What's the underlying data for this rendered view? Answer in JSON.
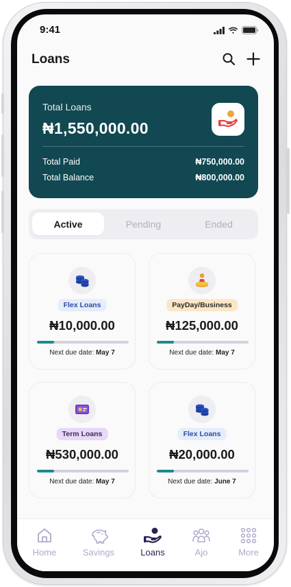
{
  "status_bar": {
    "time": "9:41"
  },
  "header": {
    "title": "Loans",
    "search_icon": "search-icon",
    "add_icon": "plus-icon"
  },
  "summary": {
    "title": "Total Loans",
    "total": "₦1,550,000.00",
    "icon": "hand-coin-icon",
    "rows": [
      {
        "label": "Total Paid",
        "value": "₦750,000.00"
      },
      {
        "label": "Total Balance",
        "value": "₦800,000.00"
      }
    ],
    "colors": {
      "card_bg": "#114852",
      "icon_accent": "#e8433f"
    }
  },
  "tabs": [
    {
      "label": "Active",
      "selected": true
    },
    {
      "label": "Pending",
      "selected": false
    },
    {
      "label": "Ended",
      "selected": false
    }
  ],
  "loans": [
    {
      "type": "Flex Loans",
      "amount": "₦10,000.00",
      "due_label": "Next due date:",
      "due_date": "May 7",
      "icon": "coin-stack-icon",
      "progress": 0.19,
      "badge_bg": "#e5edfb",
      "badge_color": "#2c4ea4"
    },
    {
      "type": "PayDay/Business",
      "amount": "₦125,000.00",
      "due_label": "Next due date:",
      "due_date": "May 7",
      "icon": "payday-icon",
      "progress": 0.19,
      "badge_bg": "#fbe7c6",
      "badge_color": "#2b2b2b"
    },
    {
      "type": "Term Loans",
      "amount": "₦530,000.00",
      "due_label": "Next due date:",
      "due_date": "May 7",
      "icon": "cash-icon",
      "progress": 0.19,
      "badge_bg": "#e7d8f7",
      "badge_color": "#3b2a5e"
    },
    {
      "type": "Flex Loans",
      "amount": "₦20,000.00",
      "due_label": "Next due date:",
      "due_date": "June 7",
      "icon": "coin-stack-icon",
      "progress": 0.19,
      "badge_bg": "#e5edfb",
      "badge_color": "#2c4ea4"
    }
  ],
  "nav": [
    {
      "label": "Home",
      "icon": "home-icon",
      "active": false
    },
    {
      "label": "Savings",
      "icon": "piggy-bank-icon",
      "active": false
    },
    {
      "label": "Loans",
      "icon": "loan-hand-icon",
      "active": true
    },
    {
      "label": "Ajo",
      "icon": "group-icon",
      "active": false
    },
    {
      "label": "More",
      "icon": "grid-icon",
      "active": false
    }
  ],
  "colors": {
    "progress_fill": "#1b8a8f",
    "progress_track": "#d2cfde",
    "nav_active": "#2a2254",
    "nav_inactive": "#b0a8cb"
  }
}
